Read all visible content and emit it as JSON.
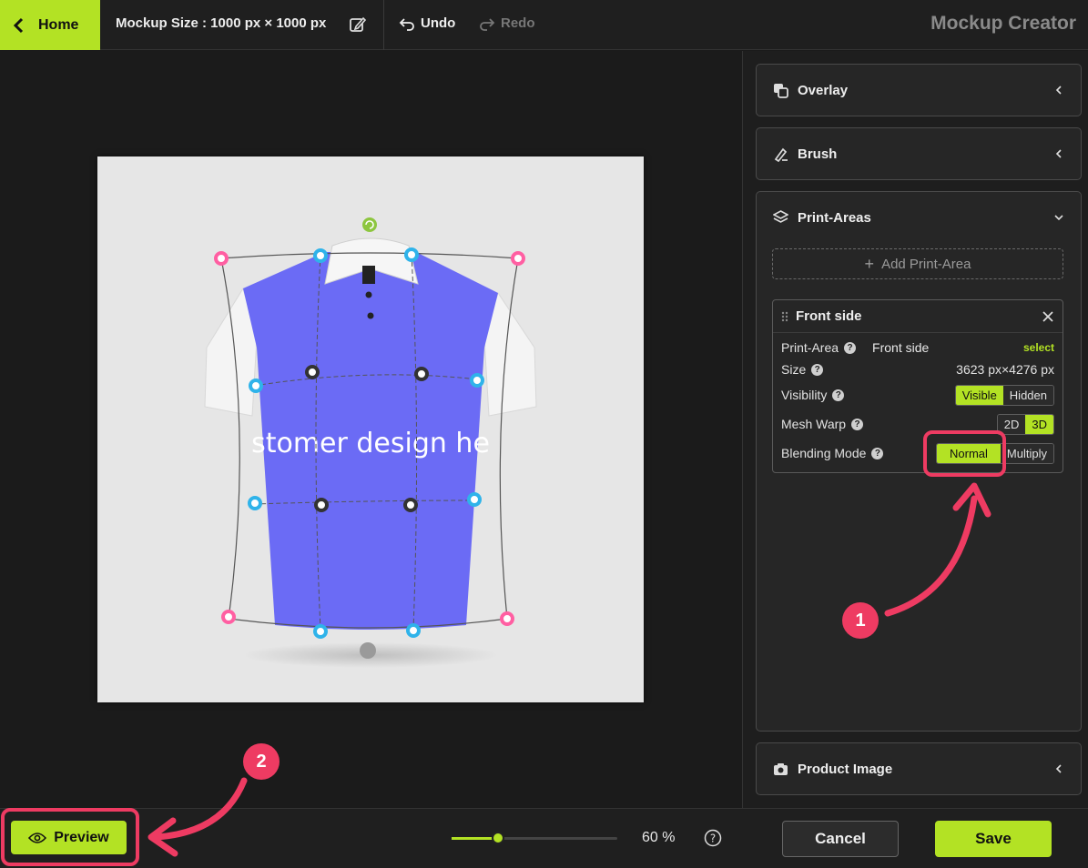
{
  "topbar": {
    "home_label": "Home",
    "mockup_size_label": "Mockup Size :  1000 px × 1000 px",
    "undo_label": "Undo",
    "redo_label": "Redo",
    "app_title": "Mockup Creator"
  },
  "canvas": {
    "design_text": "stomer design he"
  },
  "panel": {
    "overlay_label": "Overlay",
    "brush_label": "Brush",
    "print_areas_label": "Print-Areas",
    "add_print_area_label": "Add Print-Area",
    "product_image_label": "Product Image",
    "print_area_card": {
      "title": "Front side",
      "print_area_label": "Print-Area",
      "print_area_value": "Front side",
      "select_link": "select",
      "size_label": "Size",
      "size_value": "3623 px×4276 px",
      "visibility_label": "Visibility",
      "visibility_options": [
        "Visible",
        "Hidden"
      ],
      "visibility_selected": "Visible",
      "mesh_warp_label": "Mesh Warp",
      "mesh_warp_options": [
        "2D",
        "3D"
      ],
      "mesh_warp_selected": "3D",
      "blending_label": "Blending Mode",
      "blending_options": [
        "Normal",
        "Multiply"
      ],
      "blending_selected": "Normal"
    }
  },
  "bottombar": {
    "preview_label": "Preview",
    "zoom_value": "60 %",
    "zoom_fraction": 0.28,
    "cancel_label": "Cancel",
    "save_label": "Save"
  },
  "annotations": {
    "badge_1": "1",
    "badge_2": "2"
  },
  "colors": {
    "accent": "#b3e224",
    "annotation": "#ee3b62",
    "shirt": "#6b6bf5"
  }
}
